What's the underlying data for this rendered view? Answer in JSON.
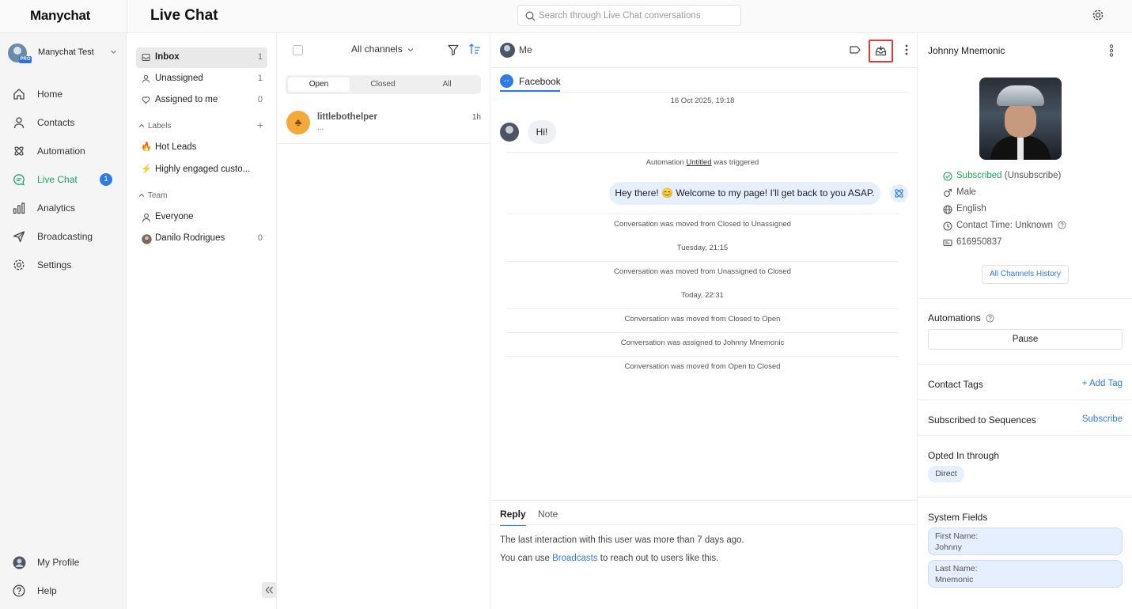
{
  "app": {
    "logo": "Manychat",
    "page_title": "Live Chat"
  },
  "search": {
    "placeholder": "Search through Live Chat conversations"
  },
  "sidebar": {
    "account_name": "Manychat Test",
    "account_badge": "PRO",
    "items": [
      {
        "label": "Home",
        "icon": "home-icon"
      },
      {
        "label": "Contacts",
        "icon": "contacts-icon"
      },
      {
        "label": "Automation",
        "icon": "automation-icon"
      },
      {
        "label": "Live Chat",
        "icon": "live-chat-icon",
        "badge": "1",
        "active": true
      },
      {
        "label": "Analytics",
        "icon": "analytics-icon"
      },
      {
        "label": "Broadcasting",
        "icon": "broadcasting-icon"
      },
      {
        "label": "Settings",
        "icon": "settings-icon"
      }
    ],
    "bottom": [
      {
        "label": "My Profile"
      },
      {
        "label": "Help"
      }
    ],
    "active_color": "#1aa55c"
  },
  "folders": {
    "inbox": {
      "label": "Inbox",
      "count": "1"
    },
    "unassigned": {
      "label": "Unassigned",
      "count": "1"
    },
    "assigned": {
      "label": "Assigned to me",
      "count": "0"
    },
    "labels_head": "Labels",
    "labels": [
      {
        "label": "Hot Leads",
        "emoji": "🔥"
      },
      {
        "label": "Highly engaged custo...",
        "emoji": "⚡"
      }
    ],
    "team_head": "Team",
    "team": [
      {
        "label": "Everyone",
        "count": ""
      },
      {
        "label": "Danilo Rodrigues",
        "count": "0"
      }
    ]
  },
  "conversations": {
    "channel_filter": "All channels",
    "segments": [
      "Open",
      "Closed",
      "All"
    ],
    "selected_segment": "Open",
    "items": [
      {
        "name": "littlebothelper",
        "preview": "...",
        "time": "1h"
      }
    ]
  },
  "chat": {
    "assignee": "Me",
    "channel_tab": "Facebook",
    "date1": "16 Oct 2025, 19:18",
    "incoming": "Hi!",
    "auto_pre": "Automation ",
    "auto_name": "Untitled",
    "auto_post": " was triggered",
    "outgoing": "Hey there! 😊 Welcome to my page! I'll get back to you ASAP.",
    "event1": "Conversation was moved from Closed to Unassigned",
    "date2": "Tuesday, 21:15",
    "event2": "Conversation was moved from Unassigned to Closed",
    "date3": "Today, 22:31",
    "event3": "Conversation was moved from Closed to Open",
    "event4": "Conversation was assigned to Johnny Mnemonic",
    "event5": "Conversation was moved from Open to Closed",
    "composer": {
      "tab_reply": "Reply",
      "tab_note": "Note",
      "line1": "The last interaction with this user was more than 7 days ago.",
      "line2_pre": "You can use ",
      "line2_link": "Broadcasts",
      "line2_post": " to reach out to users like this."
    },
    "highlight_color": "#e53935"
  },
  "profile": {
    "name": "Johnny Mnemonic",
    "subscribed": "Subscribed",
    "unsubscribe": " (Unsubscribe)",
    "gender": "Male",
    "language": "English",
    "contact_time": "Contact Time: Unknown",
    "id": "616950837",
    "history_btn": "All Channels History",
    "automations_label": "Automations",
    "pause_btn": "Pause",
    "tags_label": "Contact Tags",
    "add_tag": "+ Add Tag",
    "sequences_label": "Subscribed to Sequences",
    "subscribe": "Subscribe",
    "opted_label": "Opted In through",
    "opted_value": "Direct",
    "system_label": "System Fields",
    "first_name_key": "First Name:",
    "first_name_val": "Johnny",
    "last_name_key": "Last Name:",
    "last_name_val": "Mnemonic"
  }
}
